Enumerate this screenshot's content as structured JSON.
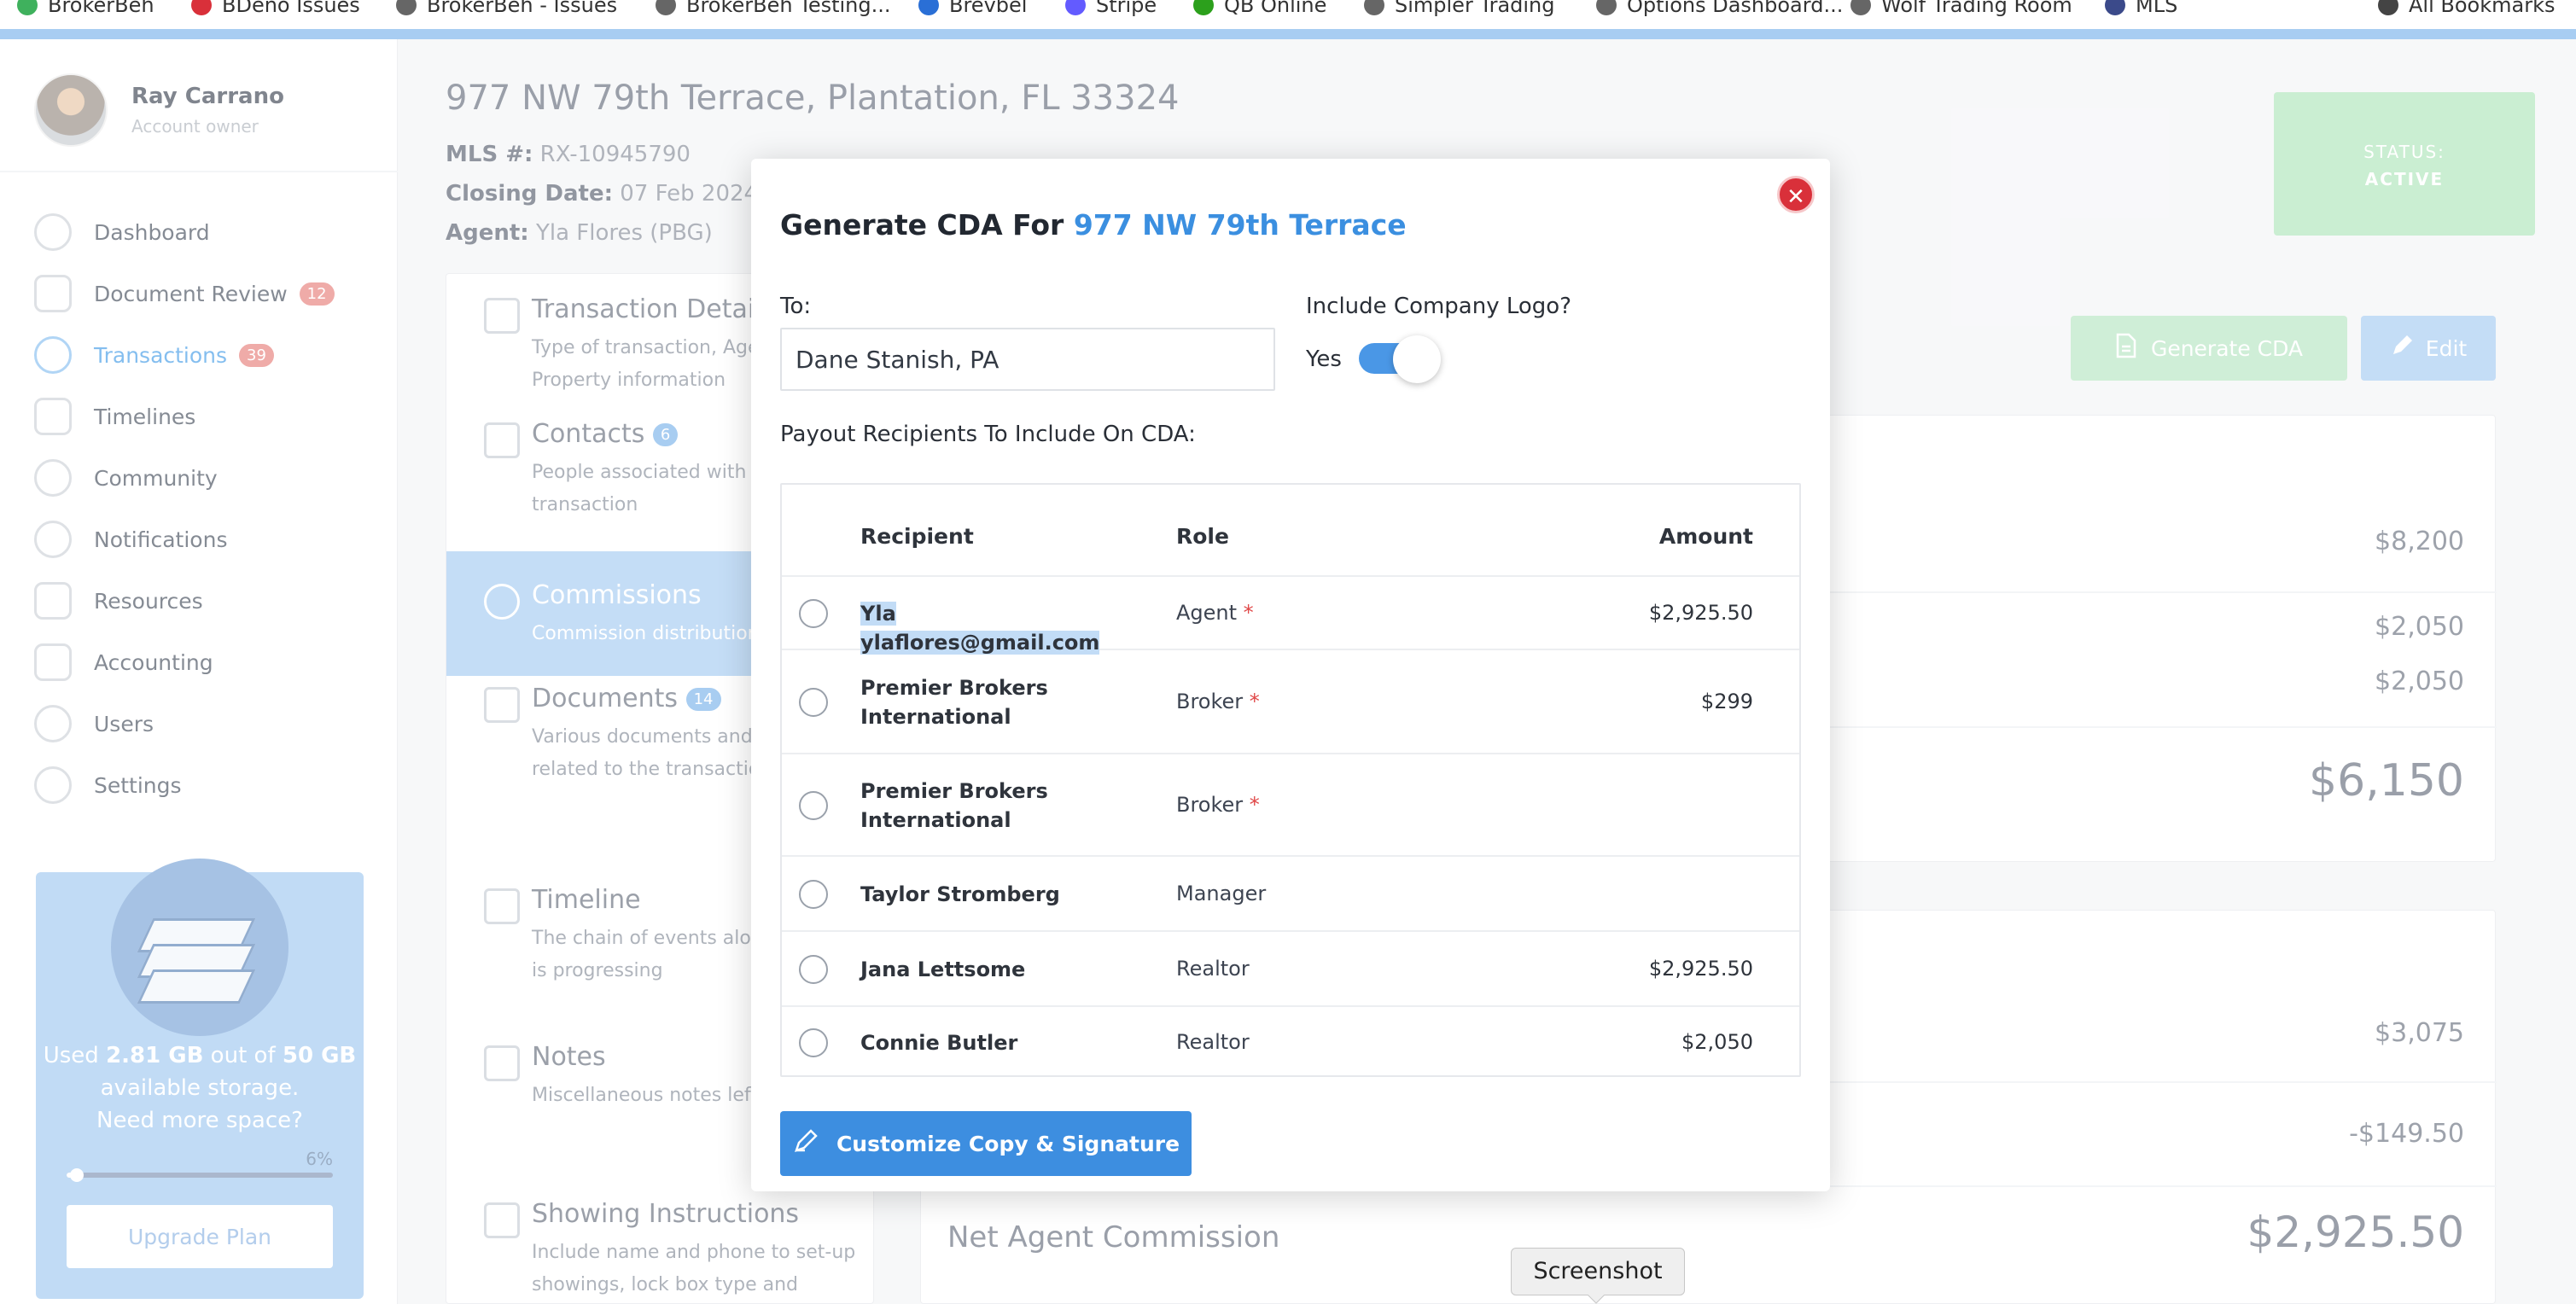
{
  "bookmarks": [
    {
      "label": "BrokerBeh",
      "color": "#3fb15d"
    },
    {
      "label": "BDeno Issues",
      "color": "#d9303a"
    },
    {
      "label": "BrokerBeh - Issues",
      "color": "#666666"
    },
    {
      "label": "BrokerBeh Testing...",
      "color": "#666666"
    },
    {
      "label": "Brevbel",
      "color": "#2a6fd6"
    },
    {
      "label": "Stripe",
      "color": "#635bff"
    },
    {
      "label": "QB Online",
      "color": "#2ca01c"
    },
    {
      "label": "Simpler Trading",
      "color": "#666666"
    },
    {
      "label": "Options Dashboard...",
      "color": "#666666"
    },
    {
      "label": "Wolf Trading Room",
      "color": "#666666"
    },
    {
      "label": "MLS",
      "color": "#3b4a8a"
    },
    {
      "label": "All Bookmarks",
      "color": "#444444"
    }
  ],
  "profile": {
    "name": "Ray Carrano",
    "role": "Account owner"
  },
  "nav": [
    {
      "label": "Dashboard",
      "icon": "gauge-icon",
      "badge": ""
    },
    {
      "label": "Document Review",
      "icon": "document-check-icon",
      "badge": "12"
    },
    {
      "label": "Transactions",
      "icon": "dollar-circle-icon",
      "badge": "39"
    },
    {
      "label": "Timelines",
      "icon": "timeline-icon",
      "badge": ""
    },
    {
      "label": "Community",
      "icon": "people-icon",
      "badge": ""
    },
    {
      "label": "Notifications",
      "icon": "chat-bubble-icon",
      "badge": ""
    },
    {
      "label": "Resources",
      "icon": "folder-icon",
      "badge": ""
    },
    {
      "label": "Accounting",
      "icon": "calculator-icon",
      "badge": ""
    },
    {
      "label": "Users",
      "icon": "user-icon",
      "badge": ""
    },
    {
      "label": "Settings",
      "icon": "gear-icon",
      "badge": ""
    }
  ],
  "storage": {
    "used_prefix": "Used ",
    "used": "2.81 GB",
    "mid": " out of ",
    "total": "50 GB",
    "suffix": " available storage.",
    "question": "Need more space?",
    "percent_label": "6%",
    "percent": 0.06,
    "upgrade_label": "Upgrade Plan"
  },
  "transaction": {
    "address": "977 NW 79th Terrace, Plantation, FL 33324",
    "mls_label": "MLS #:",
    "mls_value": "RX-10945790",
    "closing_label": "Closing Date:",
    "closing_value": "07 Feb 2024",
    "agent_label": "Agent:",
    "agent_value": "Yla Flores (PBG)"
  },
  "status": {
    "label": "STATUS:",
    "value": "ACTIVE"
  },
  "actions": {
    "generate_cda": "Generate CDA",
    "edit": "Edit"
  },
  "sections": [
    {
      "title": "Transaction Details",
      "desc": "Type of transaction, Agent, Property information",
      "count": "",
      "icon": "building-icon"
    },
    {
      "title": "Contacts",
      "desc": "People associated with the transaction",
      "count": "6",
      "icon": "contact-card-icon"
    },
    {
      "title": "Commissions",
      "desc": "Commission distribution",
      "count": "",
      "icon": "hand-coin-icon"
    },
    {
      "title": "Documents",
      "desc": "Various documents and contracts related to the transaction",
      "count": "14",
      "icon": "document-icon"
    },
    {
      "title": "Timeline",
      "desc": "The chain of events along the deal is progressing",
      "count": "",
      "icon": "timeline-bars-icon"
    },
    {
      "title": "Notes",
      "desc": "Miscellaneous notes left by agents",
      "count": "",
      "icon": "note-icon"
    },
    {
      "title": "Showing Instructions",
      "desc": "Include name and phone to set-up showings, lock box type and",
      "count": "",
      "icon": "house-icon"
    }
  ],
  "commission_values": [
    "$8,200",
    "$2,050",
    "$2,050",
    "$6,150",
    "$3,075",
    "-$149.50",
    "$2,925.50"
  ],
  "net_agent_commission_label": "Net Agent Commission",
  "modal": {
    "title_prefix": "Generate CDA For ",
    "title_address": "977 NW 79th Terrace",
    "to_label": "To:",
    "to_value": "Dane Stanish, PA",
    "logo_label": "Include Company Logo?",
    "logo_toggle_label": "Yes",
    "logo_enabled": true,
    "payout_label": "Payout Recipients To Include On CDA:",
    "columns": {
      "recipient": "Recipient",
      "role": "Role",
      "amount": "Amount"
    },
    "recipients": [
      {
        "name": "Yla ylaflores@gmail.com",
        "role": "Agent",
        "required": true,
        "amount": "$2,925.50",
        "selected_text": true
      },
      {
        "name": "Premier Brokers International",
        "role": "Broker",
        "required": true,
        "amount": "$299",
        "selected_text": false
      },
      {
        "name": "Premier Brokers International",
        "role": "Broker",
        "required": true,
        "amount": "",
        "selected_text": false
      },
      {
        "name": "Taylor Stromberg",
        "role": "Manager",
        "required": false,
        "amount": "",
        "selected_text": false
      },
      {
        "name": "Jana Lettsome",
        "role": "Realtor",
        "required": false,
        "amount": "$2,925.50",
        "selected_text": false
      },
      {
        "name": "Connie Butler",
        "role": "Realtor",
        "required": false,
        "amount": "$2,050",
        "selected_text": false
      }
    ],
    "customize_label": "Customize Copy & Signature"
  },
  "tooltip": "Screenshot",
  "colors": {
    "accent": "#3b8fe0",
    "status_green": "#b2e6bd",
    "close_red": "#d9303a",
    "badge_red": "#e8837f"
  }
}
